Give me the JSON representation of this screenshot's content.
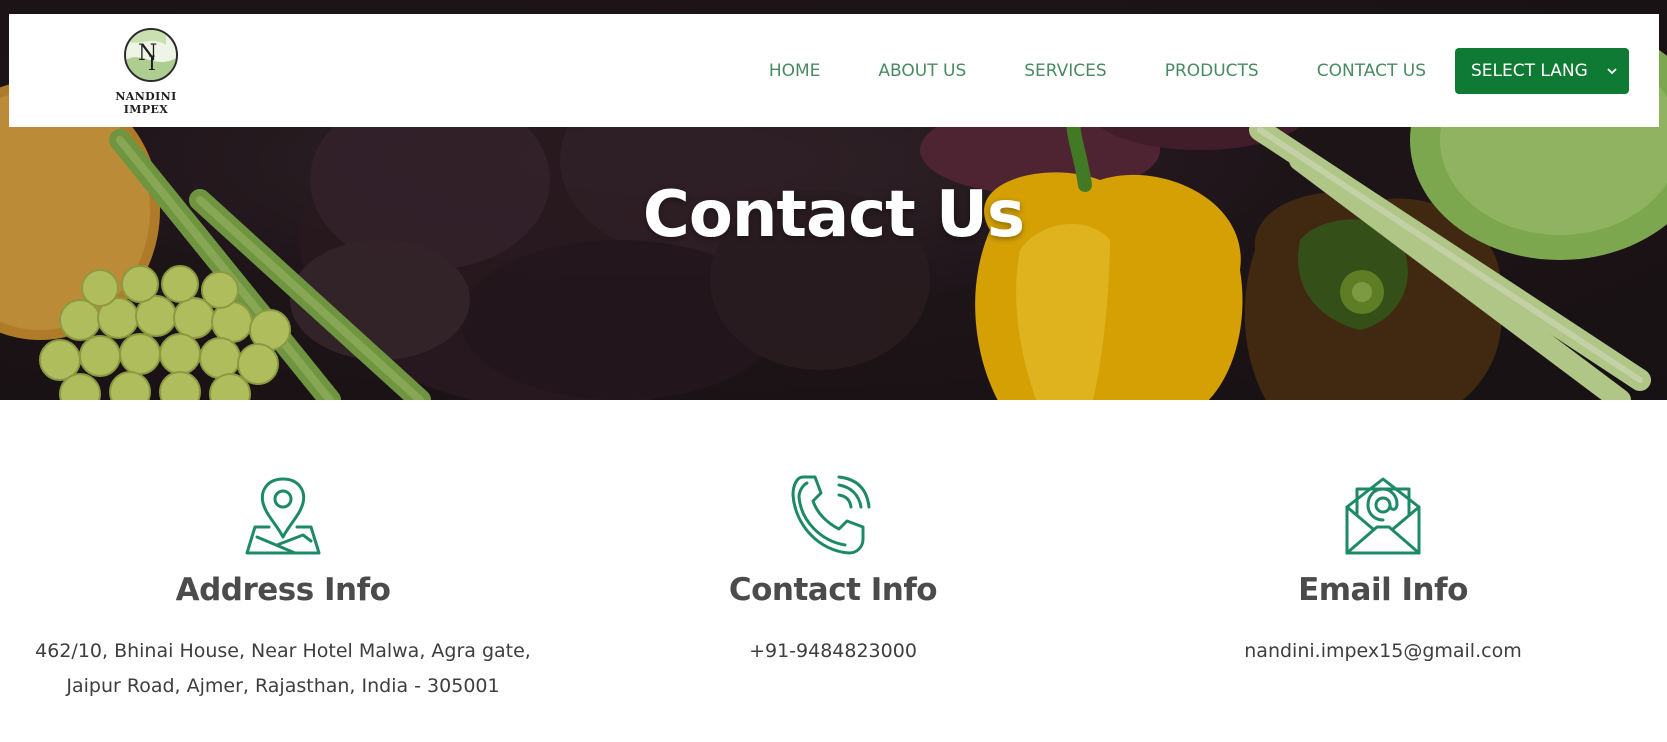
{
  "header": {
    "logo_text": "NANDINI IMPEX",
    "nav": [
      "HOME",
      "ABOUT US",
      "SERVICES",
      "PRODUCTS",
      "CONTACT US"
    ],
    "language_select": "SELECT LANG"
  },
  "hero": {
    "title": "Contact Us"
  },
  "cards": [
    {
      "icon": "map-pin-icon",
      "title": "Address Info",
      "lines": [
        "462/10, Bhinai House, Near Hotel Malwa, Agra gate,",
        "Jaipur Road, Ajmer, Rajasthan, India - 305001"
      ]
    },
    {
      "icon": "phone-icon",
      "title": "Contact Info",
      "lines": [
        "+91-9484823000"
      ]
    },
    {
      "icon": "email-icon",
      "title": "Email Info",
      "lines": [
        "nandini.impex15@gmail.com"
      ]
    }
  ],
  "colors": {
    "brand_green": "#0e7a34",
    "nav_text": "#4a8a62",
    "icon_green": "#1c8a64",
    "heading": "#4b4b4b"
  }
}
